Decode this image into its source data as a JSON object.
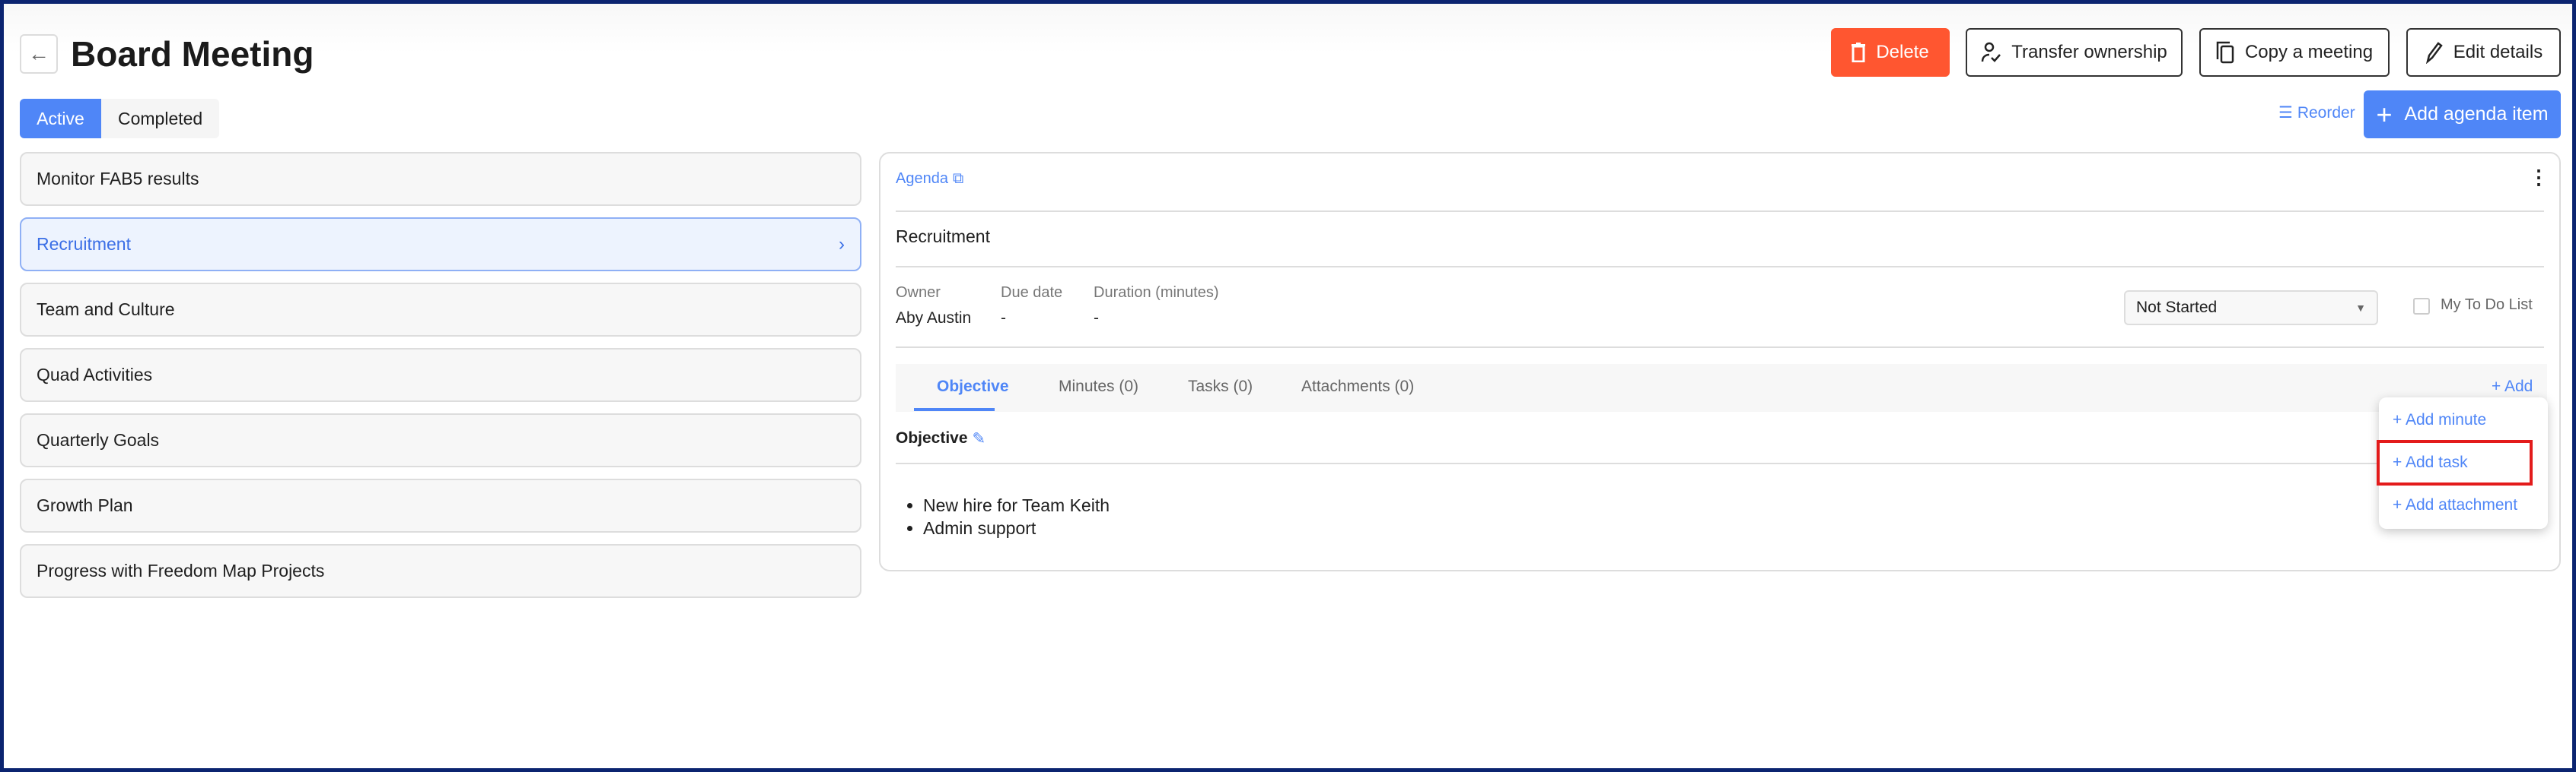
{
  "header": {
    "title": "Board Meeting",
    "back_icon": "arrow-left-icon"
  },
  "toolbar": {
    "delete": "Delete",
    "transfer": "Transfer ownership",
    "copy": "Copy a meeting",
    "edit": "Edit details",
    "reorder": "Reorder",
    "add_agenda": "Add agenda item"
  },
  "filter_tabs": [
    {
      "label": "Active",
      "selected": true
    },
    {
      "label": "Completed",
      "selected": false
    }
  ],
  "agenda_items": [
    {
      "label": "Monitor FAB5 results"
    },
    {
      "label": "Recruitment",
      "selected": true
    },
    {
      "label": "Team and Culture"
    },
    {
      "label": "Quad Activities"
    },
    {
      "label": "Quarterly Goals"
    },
    {
      "label": "Growth Plan"
    },
    {
      "label": "Progress with Freedom Map Projects"
    }
  ],
  "detail": {
    "agenda_link": "Agenda",
    "item_title": "Recruitment",
    "owner_label": "Owner",
    "owner": "Aby Austin",
    "due_label": "Due date",
    "due": "-",
    "duration_label": "Duration (minutes)",
    "duration": "-",
    "status": "Not Started",
    "todo_label": "My To Do List",
    "todo_checked": false,
    "tabs": [
      {
        "label": "Objective"
      },
      {
        "label": "Minutes (0)"
      },
      {
        "label": "Tasks (0)"
      },
      {
        "label": "Attachments (0)"
      }
    ],
    "add_label": "+ Add",
    "objective_heading": "Objective",
    "objective_bullets": [
      "New hire for Team Keith",
      "Admin support"
    ]
  },
  "add_menu": {
    "items": [
      "+ Add minute",
      "+ Add task",
      "+ Add attachment"
    ],
    "highlighted": "+ Add task"
  },
  "colors": {
    "accent": "#4f86f7",
    "danger": "#ff5630",
    "highlight": "#e31b1b",
    "frame": "#0b2470"
  }
}
